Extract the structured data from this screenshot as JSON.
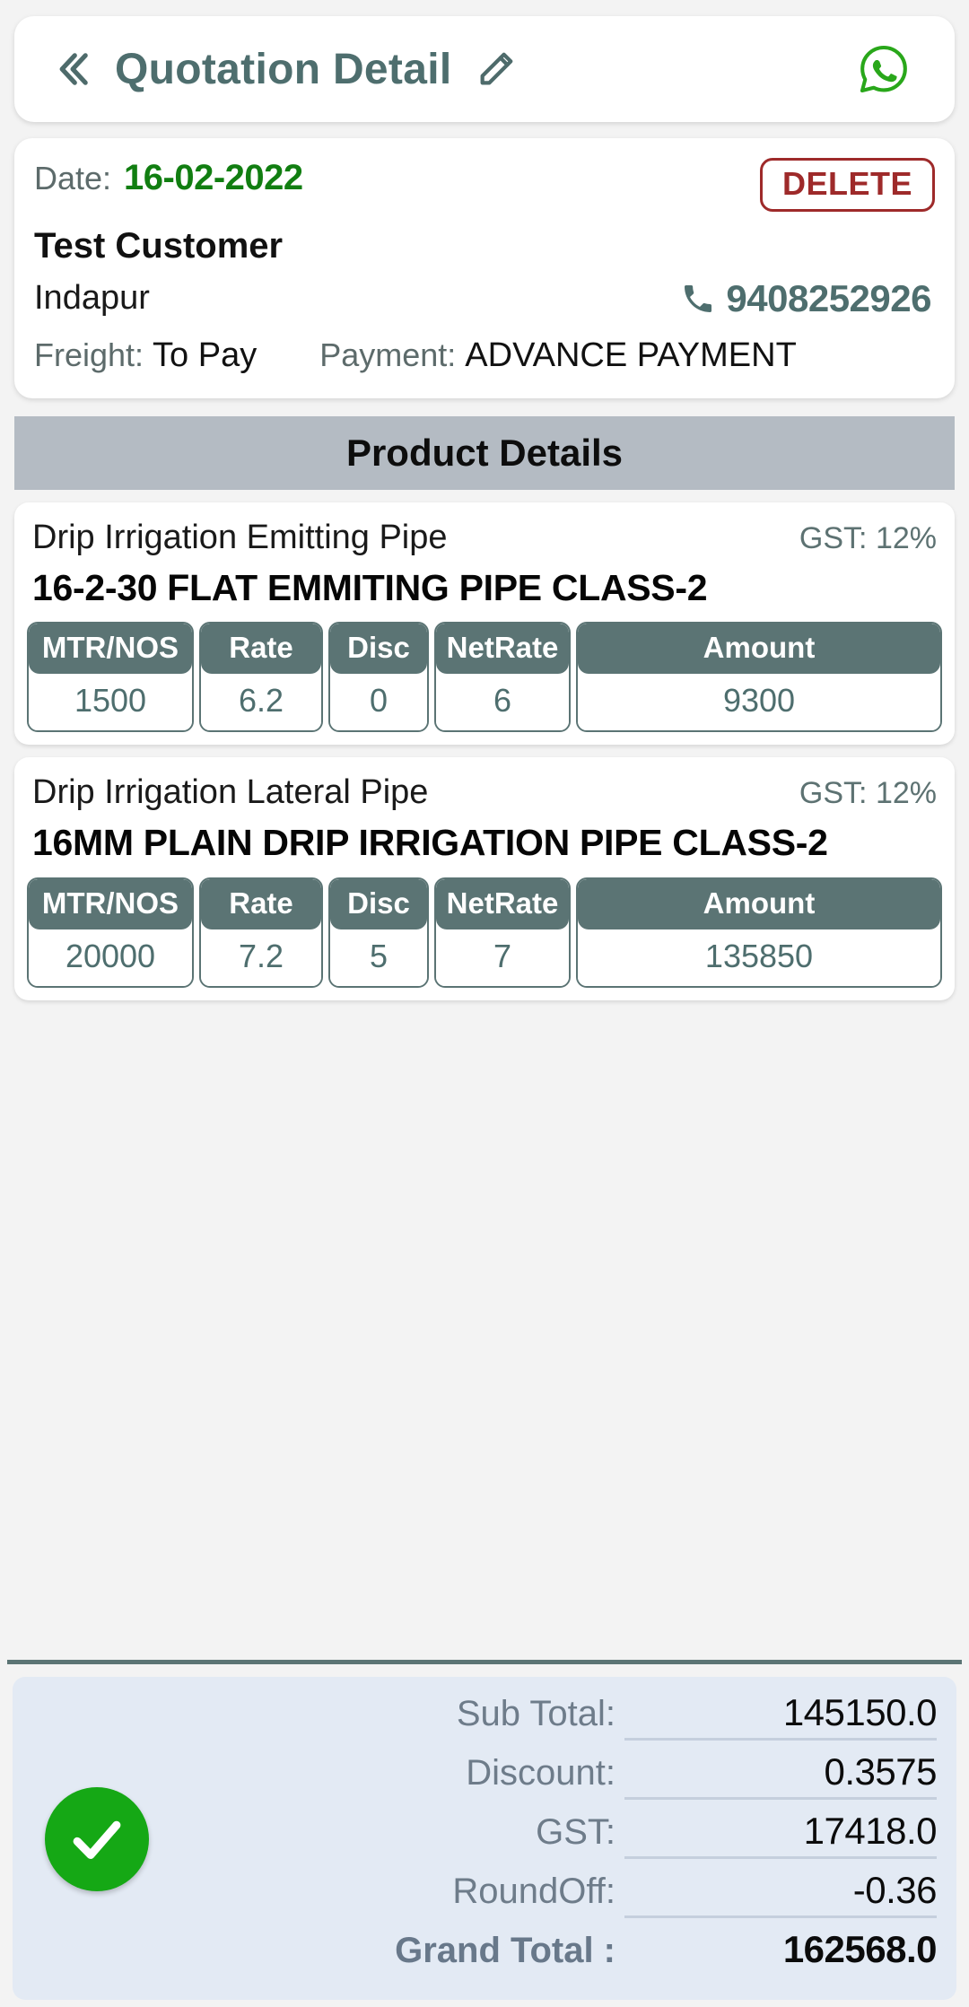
{
  "appbar": {
    "back_icon": "double-chevron-left-icon",
    "title": "Quotation Detail",
    "edit_icon": "pencil-icon",
    "share_icon": "whatsapp-icon"
  },
  "customer": {
    "date_label": "Date:",
    "date_value": "16-02-2022",
    "delete_label": "DELETE",
    "name": "Test Customer",
    "city": "Indapur",
    "phone_icon": "phone-icon",
    "phone": "9408252926",
    "freight_label": "Freight:",
    "freight_value": "To Pay",
    "payment_label": "Payment:",
    "payment_value": "ADVANCE PAYMENT"
  },
  "section": {
    "product_details_title": "Product Details"
  },
  "table_headers": {
    "qty": "MTR/NOS",
    "rate": "Rate",
    "disc": "Disc",
    "netrate": "NetRate",
    "amount": "Amount"
  },
  "products": [
    {
      "category": "Drip Irrigation Emitting Pipe",
      "gst": "GST: 12%",
      "name": "16-2-30 FLAT EMMITING PIPE CLASS-2",
      "qty": "1500",
      "rate": "6.2",
      "disc": "0",
      "netrate": "6",
      "amount": "9300"
    },
    {
      "category": "Drip Irrigation Lateral Pipe",
      "gst": "GST: 12%",
      "name": "16MM PLAIN DRIP IRRIGATION PIPE CLASS-2",
      "qty": "20000",
      "rate": "7.2",
      "disc": "5",
      "netrate": "7",
      "amount": "135850"
    }
  ],
  "totals": {
    "confirm_icon": "check-circle-icon",
    "rows": [
      {
        "label": "Sub Total:",
        "value": "145150.0"
      },
      {
        "label": "Discount:",
        "value": "0.3575"
      },
      {
        "label": "GST:",
        "value": "17418.0"
      },
      {
        "label": "RoundOff:",
        "value": "-0.36"
      }
    ],
    "grand_label": "Grand Total :",
    "grand_value": "162568.0"
  },
  "colors": {
    "accent_teal": "#4e6e6e",
    "table_header": "#5b7474",
    "date_green": "#117e11",
    "delete_red": "#9e2a2a",
    "section_gray": "#b4bbc3",
    "totals_bg": "#e3eaf4",
    "check_green": "#15a815",
    "whatsapp_green": "#29a71a"
  }
}
